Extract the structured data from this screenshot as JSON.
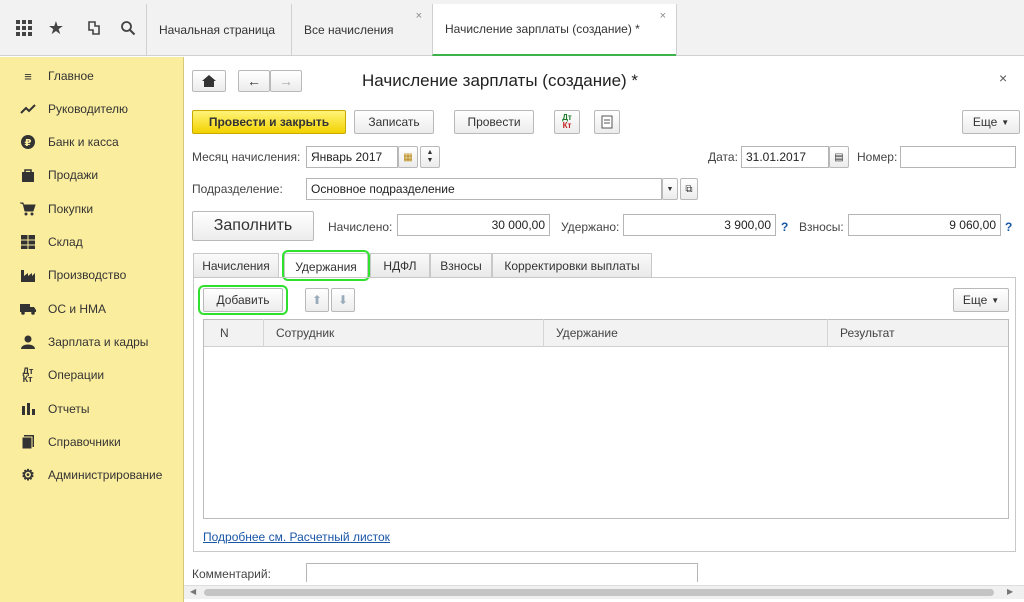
{
  "topbar": {
    "icons": [
      "apps-grid-icon",
      "star-icon",
      "history-icon",
      "search-icon"
    ],
    "tabs": [
      {
        "label": "Начальная страница",
        "closable": false
      },
      {
        "label": "Все начисления",
        "closable": true
      },
      {
        "label": "Начисление зарплаты (создание) *",
        "closable": true,
        "active": true
      }
    ]
  },
  "sidebar": {
    "items": [
      {
        "label": "Главное",
        "icon": "menu-icon"
      },
      {
        "label": "Руководителю",
        "icon": "trend-icon"
      },
      {
        "label": "Банк и касса",
        "icon": "ruble-icon"
      },
      {
        "label": "Продажи",
        "icon": "bag-icon"
      },
      {
        "label": "Покупки",
        "icon": "cart-icon"
      },
      {
        "label": "Склад",
        "icon": "warehouse-icon"
      },
      {
        "label": "Производство",
        "icon": "factory-icon"
      },
      {
        "label": "ОС и НМА",
        "icon": "truck-icon"
      },
      {
        "label": "Зарплата и кадры",
        "icon": "person-icon"
      },
      {
        "label": "Операции",
        "icon": "dt-kt-icon"
      },
      {
        "label": "Отчеты",
        "icon": "bar-chart-icon"
      },
      {
        "label": "Справочники",
        "icon": "books-icon"
      },
      {
        "label": "Администрирование",
        "icon": "gear-icon"
      }
    ]
  },
  "form": {
    "title": "Начисление зарплаты (создание) *",
    "toolbar": {
      "post_close": "Провести и закрыть",
      "save": "Записать",
      "post": "Провести",
      "more": "Еще",
      "dtkt": "Дт Кт"
    },
    "month_label": "Месяц начисления:",
    "month_value": "Январь 2017",
    "date_label": "Дата:",
    "date_value": "31.01.2017",
    "number_label": "Номер:",
    "number_value": "",
    "division_label": "Подразделение:",
    "division_value": "Основное подразделение",
    "fill_button": "Заполнить",
    "accrued_label": "Начислено:",
    "accrued_value": "30 000,00",
    "withheld_label": "Удержано:",
    "withheld_value": "3 900,00",
    "contrib_label": "Взносы:",
    "contrib_value": "9 060,00",
    "qmark": "?",
    "tabs": [
      "Начисления",
      "Удержания",
      "НДФЛ",
      "Взносы",
      "Корректировки выплаты"
    ],
    "table_toolbar": {
      "add": "Добавить",
      "more": "Еще"
    },
    "columns": [
      "N",
      "Сотрудник",
      "Удержание",
      "Результат"
    ],
    "link": "Подробнее см. Расчетный листок",
    "comment_label": "Комментарий:"
  },
  "colors": {
    "sidebar_bg": "#fbed9e",
    "primary_btn": "#f3d200",
    "highlight": "#2fe02f",
    "link": "#1a56a6"
  }
}
